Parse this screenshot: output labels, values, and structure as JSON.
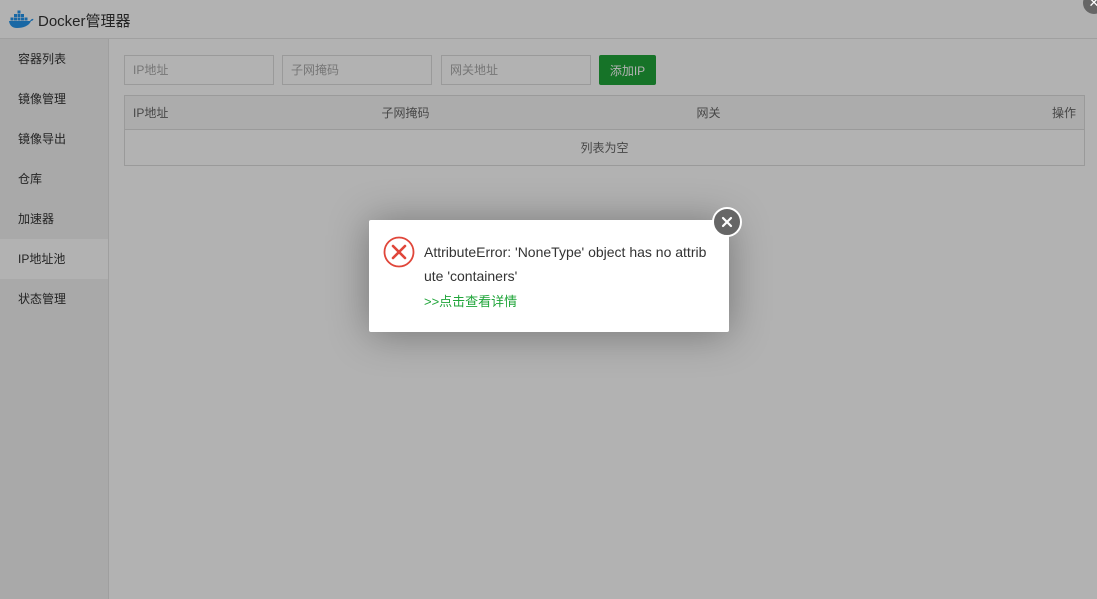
{
  "window": {
    "title": "Docker管理器",
    "close_glyph": "✕"
  },
  "sidebar": {
    "items": [
      {
        "label": "容器列表"
      },
      {
        "label": "镜像管理"
      },
      {
        "label": "镜像导出"
      },
      {
        "label": "仓库"
      },
      {
        "label": "加速器"
      },
      {
        "label": "IP地址池",
        "active": true
      },
      {
        "label": "状态管理"
      }
    ]
  },
  "form": {
    "ip_placeholder": "IP地址",
    "subnet_placeholder": "子网掩码",
    "gateway_placeholder": "网关地址",
    "add_button": "添加IP"
  },
  "table": {
    "columns": [
      "IP地址",
      "子网掩码",
      "网关",
      "操作"
    ],
    "empty_text": "列表为空"
  },
  "dialog": {
    "message": "AttributeError: 'NoneType' object has no attribute 'containers'",
    "link": ">>点击查看详情",
    "icon": "error-circle-icon"
  },
  "colors": {
    "accent_green": "#20a53a",
    "error_red": "#e0463a",
    "overlay": "rgba(0,0,0,0.3)"
  }
}
